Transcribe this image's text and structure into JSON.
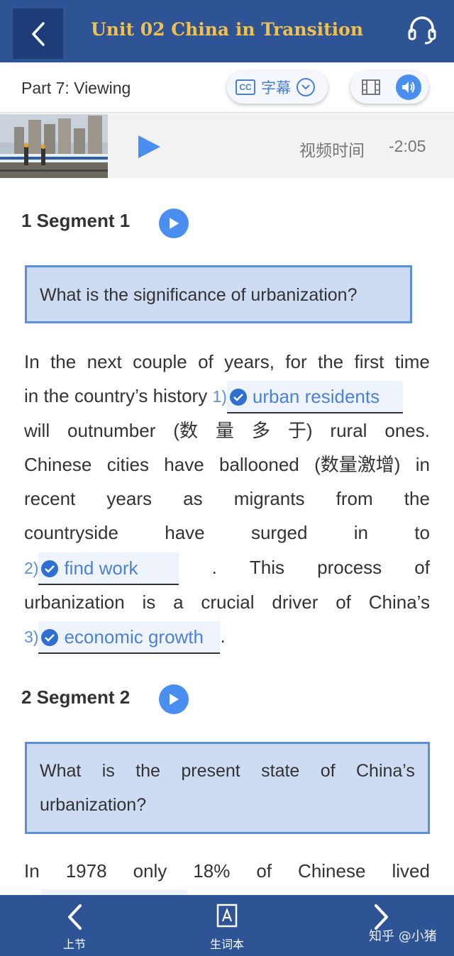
{
  "header": {
    "title": "Unit 02 China in Transition"
  },
  "subbar": {
    "part_label": "Part 7: Viewing",
    "caption_label": "字幕",
    "caption_badge": "CC"
  },
  "video": {
    "time_label": "视频时间",
    "time_value": "-2:05"
  },
  "segments": [
    {
      "title": "1 Segment 1",
      "question": "What is the significance of urbanization?",
      "lines": [
        [
          "In",
          "the",
          "next",
          "couple",
          "of",
          "years,",
          "for",
          "the",
          "first",
          "time"
        ],
        [
          "in the country’s history"
        ],
        [
          "will",
          "outnumber",
          "(数",
          "量",
          "多",
          "于)",
          "rural",
          "ones."
        ],
        [
          "Chinese",
          "cities",
          "have",
          "ballooned",
          "(数量激增)",
          "in"
        ],
        [
          "recent",
          "years",
          "as",
          "migrants",
          "from",
          "the"
        ],
        [
          "countryside",
          "have",
          "surged",
          "in",
          "to"
        ],
        [
          ".",
          "This",
          "process",
          "of"
        ],
        [
          "urbanization",
          "is",
          "a",
          "crucial",
          "driver",
          "of",
          "China’s"
        ],
        [
          "."
        ]
      ],
      "answers": [
        {
          "number": "1)",
          "text": "urban residents"
        },
        {
          "number": "2)",
          "text": "find work"
        },
        {
          "number": "3)",
          "text": "economic growth"
        }
      ]
    },
    {
      "title": "2 Segment 2",
      "question_lines": [
        [
          "What",
          "is",
          "the",
          "present",
          "state",
          "of",
          "China’s"
        ],
        [
          "urbanization?"
        ]
      ],
      "lines": [
        [
          "In",
          "1978",
          "only",
          "18%",
          "of",
          "Chinese",
          "lived"
        ]
      ]
    }
  ],
  "footer": {
    "prev_label": "上节",
    "vocab_label": "生词本",
    "watermark": "知乎 @小猪"
  },
  "colors": {
    "header_bg": "#2e5496",
    "title": "#f3c14a",
    "accent": "#4a8ef0",
    "answer": "#4a82d6"
  }
}
